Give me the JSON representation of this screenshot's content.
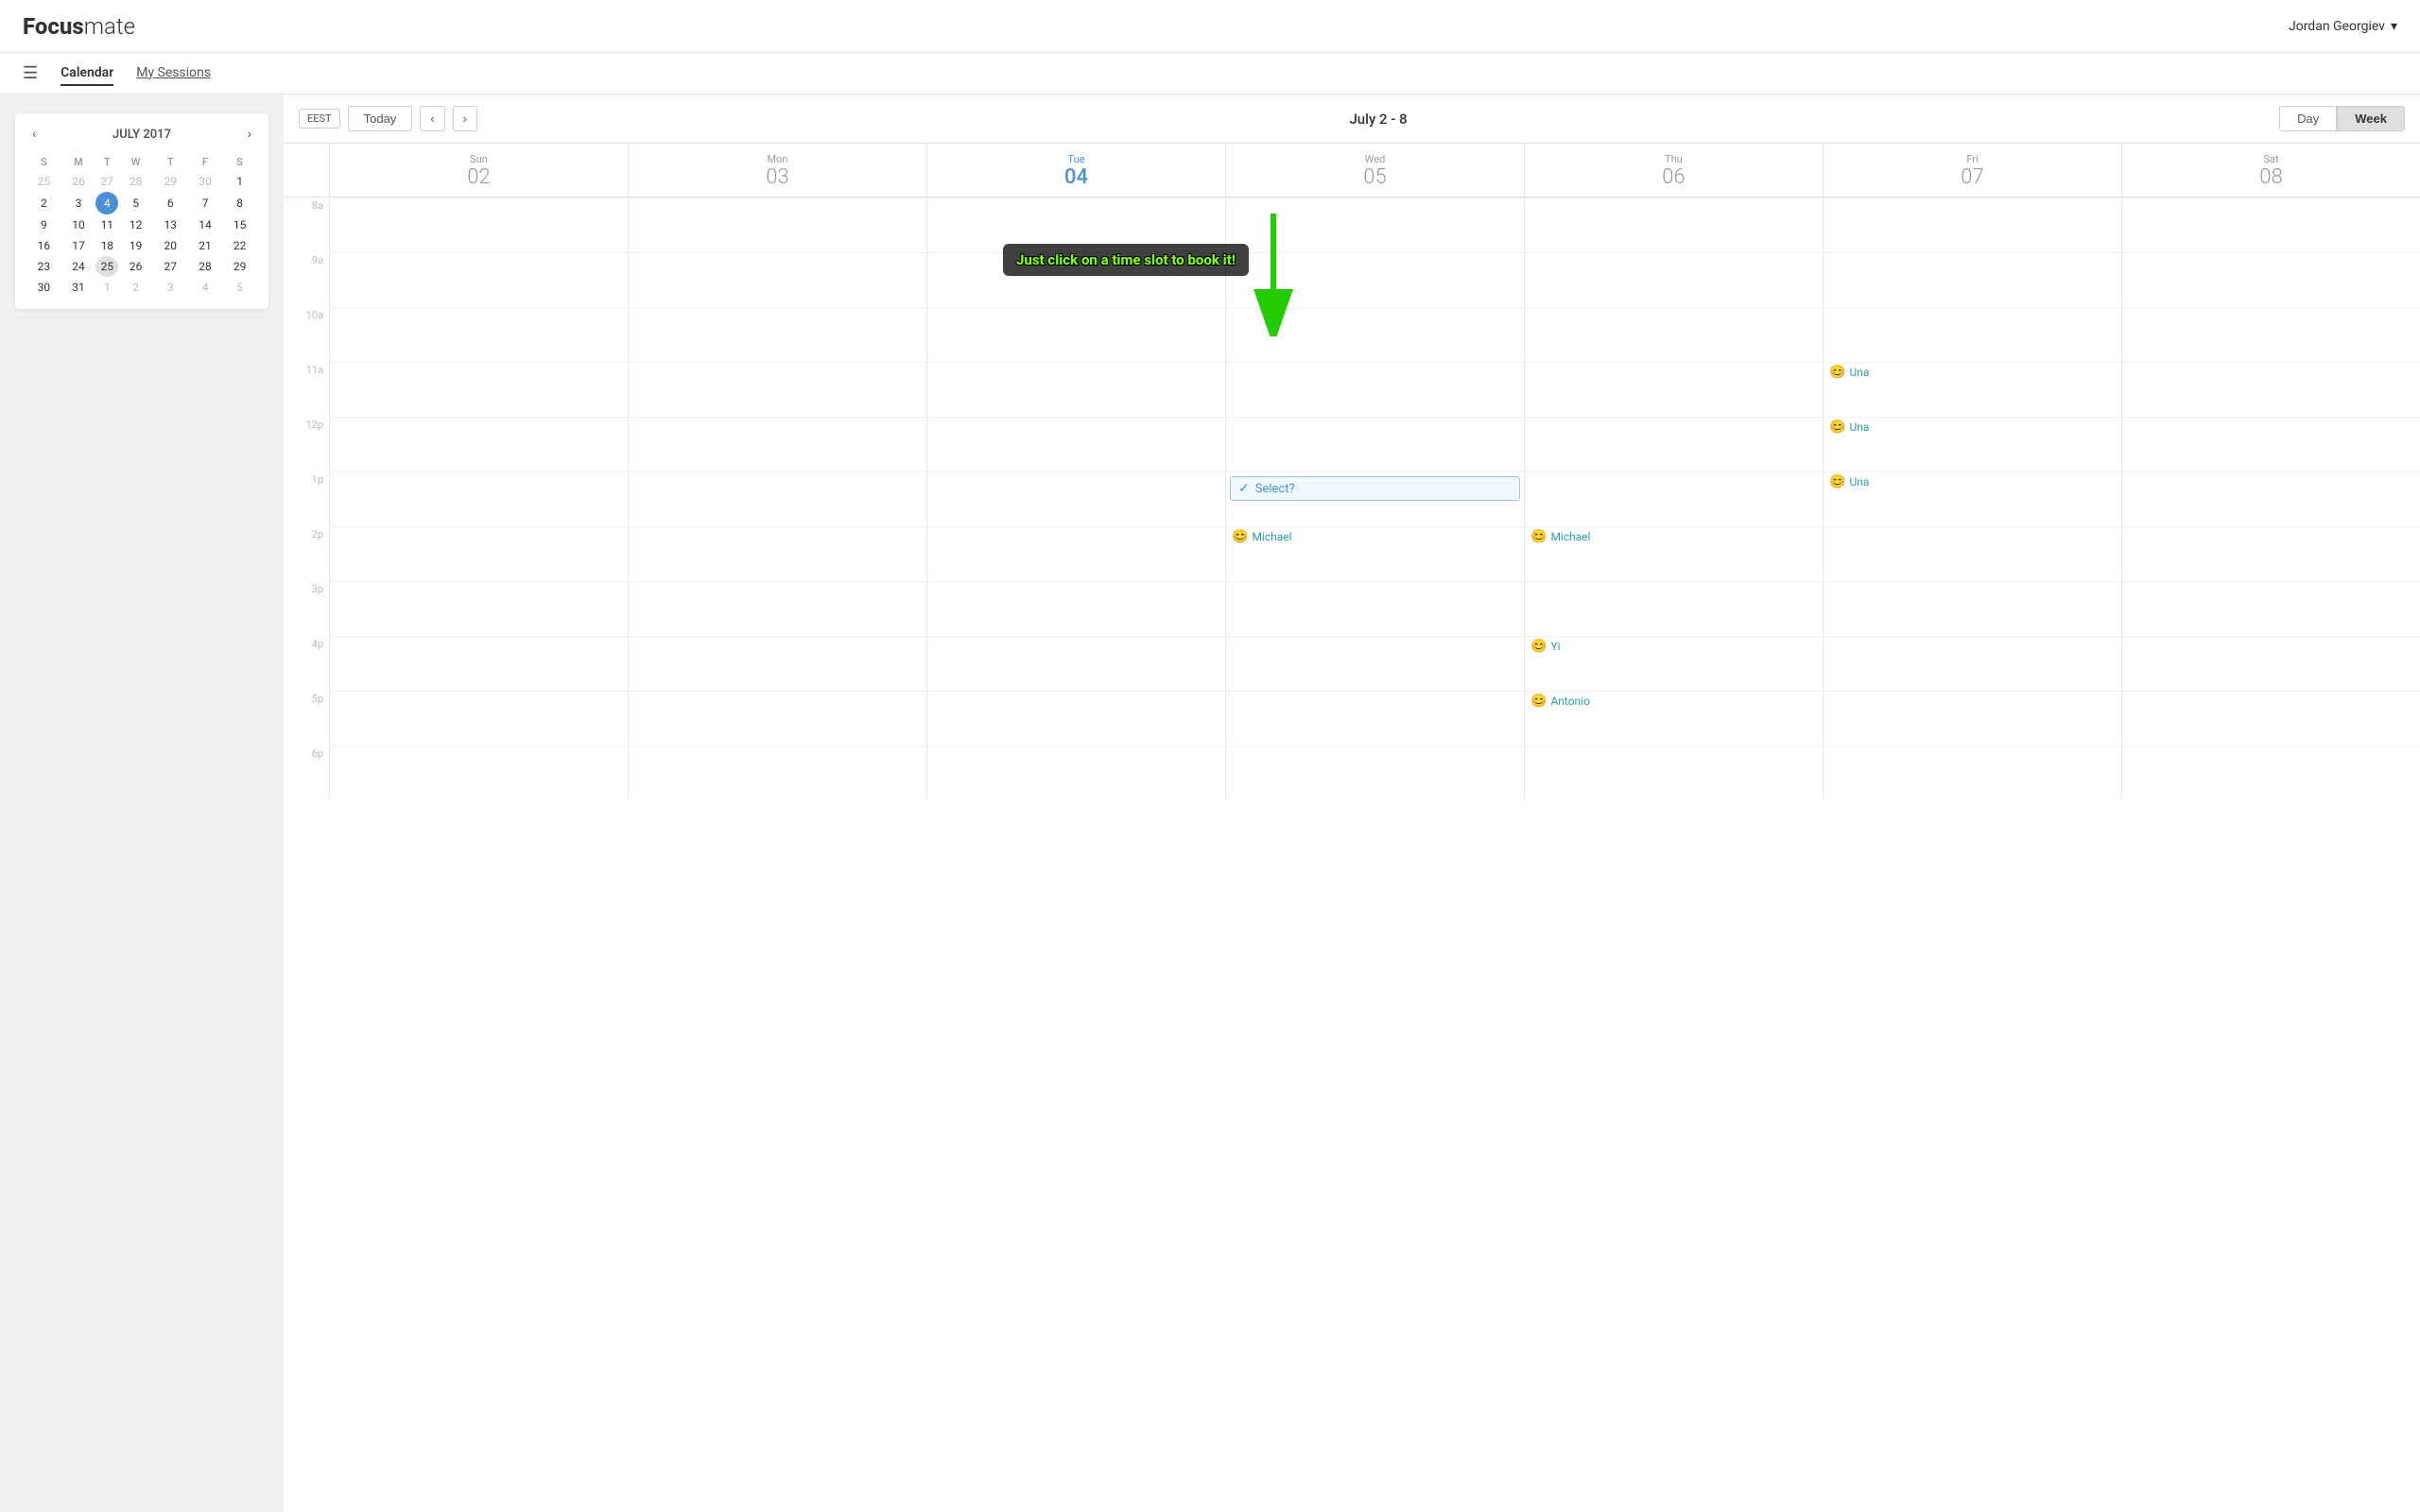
{
  "header": {
    "logo_bold": "Focus",
    "logo_light": "mate",
    "user": "Jordan Georgiev",
    "user_chevron": "▾"
  },
  "nav": {
    "hamburger": "☰",
    "items": [
      {
        "id": "calendar",
        "label": "Calendar",
        "active": true
      },
      {
        "id": "my-sessions",
        "label": "My Sessions",
        "active": false
      }
    ]
  },
  "mini_calendar": {
    "title": "JULY 2017",
    "prev": "‹",
    "next": "›",
    "day_headers": [
      "S",
      "M",
      "T",
      "W",
      "T",
      "F",
      "S"
    ],
    "weeks": [
      [
        {
          "day": "25",
          "other": true
        },
        {
          "day": "26",
          "other": true
        },
        {
          "day": "27",
          "other": true
        },
        {
          "day": "28",
          "other": true
        },
        {
          "day": "29",
          "other": true
        },
        {
          "day": "30",
          "other": true
        },
        {
          "day": "1",
          "other": false
        }
      ],
      [
        {
          "day": "2",
          "other": false
        },
        {
          "day": "3",
          "other": false
        },
        {
          "day": "4",
          "other": false,
          "today": true
        },
        {
          "day": "5",
          "other": false
        },
        {
          "day": "6",
          "other": false
        },
        {
          "day": "7",
          "other": false
        },
        {
          "day": "8",
          "other": false
        }
      ],
      [
        {
          "day": "9",
          "other": false
        },
        {
          "day": "10",
          "other": false
        },
        {
          "day": "11",
          "other": false
        },
        {
          "day": "12",
          "other": false
        },
        {
          "day": "13",
          "other": false
        },
        {
          "day": "14",
          "other": false
        },
        {
          "day": "15",
          "other": false
        }
      ],
      [
        {
          "day": "16",
          "other": false
        },
        {
          "day": "17",
          "other": false
        },
        {
          "day": "18",
          "other": false
        },
        {
          "day": "19",
          "other": false
        },
        {
          "day": "20",
          "other": false
        },
        {
          "day": "21",
          "other": false
        },
        {
          "day": "22",
          "other": false
        }
      ],
      [
        {
          "day": "23",
          "other": false
        },
        {
          "day": "24",
          "other": false
        },
        {
          "day": "25",
          "other": false,
          "selected": true
        },
        {
          "day": "26",
          "other": false
        },
        {
          "day": "27",
          "other": false
        },
        {
          "day": "28",
          "other": false
        },
        {
          "day": "29",
          "other": false
        }
      ],
      [
        {
          "day": "30",
          "other": false
        },
        {
          "day": "31",
          "other": false
        },
        {
          "day": "1",
          "other": true
        },
        {
          "day": "2",
          "other": true
        },
        {
          "day": "3",
          "other": true
        },
        {
          "day": "4",
          "other": true
        },
        {
          "day": "5",
          "other": true
        }
      ]
    ]
  },
  "toolbar": {
    "timezone": "EEST",
    "today": "Today",
    "prev": "‹",
    "next": "›",
    "date_range": "July 2 - 8",
    "day_view": "Day",
    "week_view": "Week"
  },
  "calendar": {
    "days": [
      {
        "name": "Sun",
        "num": "02",
        "today": false
      },
      {
        "name": "Mon",
        "num": "03",
        "today": false
      },
      {
        "name": "Tue",
        "num": "04",
        "today": true
      },
      {
        "name": "Wed",
        "num": "05",
        "today": false
      },
      {
        "name": "Thu",
        "num": "06",
        "today": false
      },
      {
        "name": "Fri",
        "num": "07",
        "today": false
      },
      {
        "name": "Sat",
        "num": "08",
        "today": false
      }
    ],
    "time_labels": [
      "8a",
      "9a",
      "10a",
      "11a",
      "12p",
      "1p",
      "2p",
      "3p",
      "4p",
      "5p",
      "6p"
    ],
    "tooltip": "Just click on a time slot to book it!",
    "select_label": "Select?",
    "events": {
      "fri_11a": {
        "icon": "😊",
        "name": "Una"
      },
      "fri_12p": {
        "icon": "😊",
        "name": "Una"
      },
      "fri_1p": {
        "icon": "😊",
        "name": "Una"
      },
      "wed_1p_select": "Select?",
      "wed_2p": {
        "icon": "😊",
        "name": "Michael"
      },
      "thu_2p": {
        "icon": "😊",
        "name": "Michael"
      },
      "thu_4p": {
        "icon": "😊",
        "name": "Yi"
      },
      "thu_5p": {
        "icon": "😊",
        "name": "Antonio"
      }
    }
  }
}
